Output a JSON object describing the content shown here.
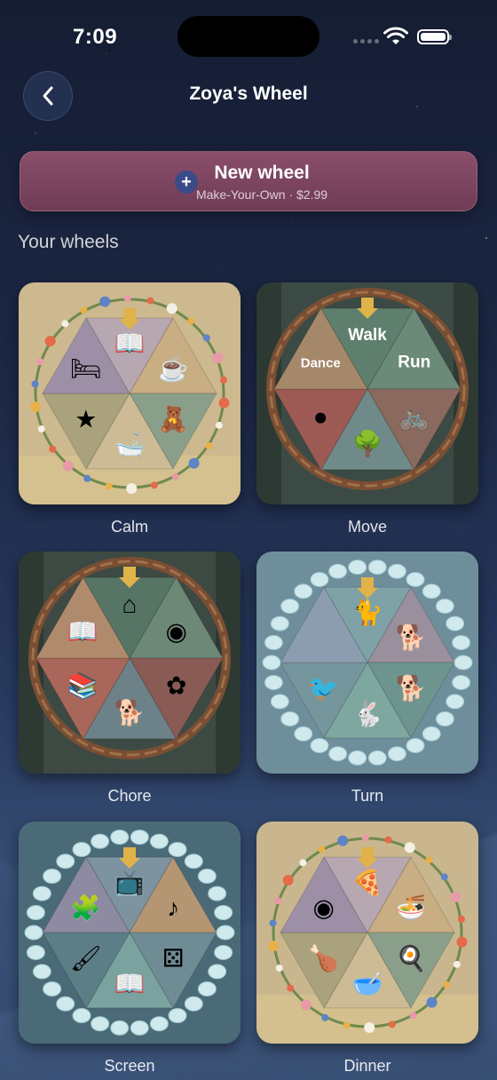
{
  "status": {
    "time": "7:09"
  },
  "header": {
    "title": "Zoya's Wheel",
    "back_icon": "chevron-left-icon"
  },
  "new_wheel": {
    "title": "New wheel",
    "subtitle": "Make-Your-Own · $2.99",
    "icon": "plus-icon"
  },
  "section_title": "Your wheels",
  "colors": {
    "accent": "#7d4661",
    "plus_bg": "#3a4b88"
  },
  "wheels": [
    {
      "name": "Calm",
      "frame": "flowers",
      "bg": "#cdb98f",
      "segments": [
        {
          "color": "#b7a7b0",
          "text": "",
          "icon": "book-icon"
        },
        {
          "color": "#c9ad83",
          "text": "",
          "icon": "teacup-icon"
        },
        {
          "color": "#8a9f8a",
          "text": "",
          "icon": "teddy-bear-icon"
        },
        {
          "color": "#ccbb94",
          "text": "",
          "icon": "bathtub-icon"
        },
        {
          "color": "#a9a27d",
          "text": "",
          "icon": "star-icon"
        },
        {
          "color": "#9c8fa6",
          "text": "",
          "icon": "bed-icon"
        }
      ]
    },
    {
      "name": "Move",
      "frame": "wood",
      "bg": "#3b4a44",
      "segments": [
        {
          "color": "#5f7f6e",
          "text": "Walk",
          "icon": ""
        },
        {
          "color": "#6c8a78",
          "text": "Run",
          "icon": ""
        },
        {
          "color": "#8a6a5e",
          "text": "",
          "icon": "bicycle-icon"
        },
        {
          "color": "#6f8a88",
          "text": "",
          "icon": "tree-icon"
        },
        {
          "color": "#9d5a54",
          "text": "",
          "icon": "ball-icon"
        },
        {
          "color": "#a5876a",
          "text": "Dance",
          "icon": ""
        }
      ]
    },
    {
      "name": "Chore",
      "frame": "wood",
      "bg": "#3d4a43",
      "segments": [
        {
          "color": "#567565",
          "text": "",
          "icon": "house-icon"
        },
        {
          "color": "#6d8876",
          "text": "",
          "icon": "plate-icon"
        },
        {
          "color": "#8a5a55",
          "text": "",
          "icon": "flower-icon"
        },
        {
          "color": "#6c8288",
          "text": "",
          "icon": "dog-icon"
        },
        {
          "color": "#a8675a",
          "text": "",
          "icon": "stacked-books-icon"
        },
        {
          "color": "#b08a6c",
          "text": "",
          "icon": "book-icon"
        }
      ]
    },
    {
      "name": "Turn",
      "frame": "stones",
      "bg": "#6f8e9c",
      "segments": [
        {
          "color": "#7fa2a6",
          "text": "",
          "icon": "cat-icon"
        },
        {
          "color": "#9a8f9c",
          "text": "",
          "icon": "dog-icon"
        },
        {
          "color": "#6d948f",
          "text": "",
          "icon": "dog-icon"
        },
        {
          "color": "#7ea7a0",
          "text": "",
          "icon": "rabbit-icon"
        },
        {
          "color": "#76969d",
          "text": "",
          "icon": "bird-icon"
        },
        {
          "color": "#8c9db0",
          "text": "",
          "icon": ""
        }
      ]
    },
    {
      "name": "Screen",
      "frame": "stones",
      "bg": "#4a6a78",
      "segments": [
        {
          "color": "#7d93a0",
          "text": "",
          "icon": "tv-icon"
        },
        {
          "color": "#b59673",
          "text": "",
          "icon": "music-note-icon"
        },
        {
          "color": "#6f8c95",
          "text": "",
          "icon": "dice-icon"
        },
        {
          "color": "#7aa3a0",
          "text": "",
          "icon": "book-icon"
        },
        {
          "color": "#5c7e86",
          "text": "",
          "icon": "paintbrush-icon"
        },
        {
          "color": "#8d8aa2",
          "text": "",
          "icon": "puzzle-icon"
        }
      ]
    },
    {
      "name": "Dinner",
      "frame": "flowers",
      "bg": "#c9b68f",
      "segments": [
        {
          "color": "#b7a7b0",
          "text": "",
          "icon": "pizza-icon"
        },
        {
          "color": "#c9ad83",
          "text": "",
          "icon": "noodles-icon"
        },
        {
          "color": "#8a9f8a",
          "text": "",
          "icon": "fried-egg-icon"
        },
        {
          "color": "#ccbb94",
          "text": "",
          "icon": "soup-icon"
        },
        {
          "color": "#a9a27d",
          "text": "",
          "icon": "drumstick-icon"
        },
        {
          "color": "#9c8fa6",
          "text": "",
          "icon": "plate-icon"
        }
      ]
    }
  ]
}
